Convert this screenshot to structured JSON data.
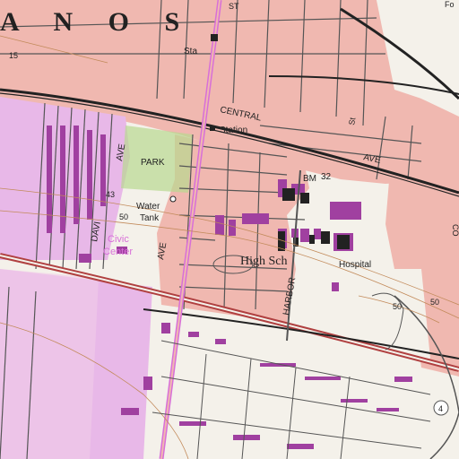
{
  "map": {
    "labels": {
      "city_partial": "A N O S",
      "station_top": "Sta",
      "station": "Station",
      "central_ave": "CENTRAL",
      "central_ave_suffix": "AVE",
      "park": "PARK",
      "bm": "BM",
      "bm_value": "32",
      "water_tank_1": "Water",
      "water_tank_2": "Tank",
      "civic_center_1": "Civic",
      "civic_center_2": "Center",
      "high_school": "High Sch",
      "hospital": "Hospital",
      "harbor": "HARBOR",
      "davi_ave": "DAVI",
      "ave_left": "AVE",
      "ave_right": "AVE",
      "contour_50_a": "50",
      "contour_50_b": "50",
      "contour_50_c": "50",
      "contour_43": "43",
      "contour_15": "15",
      "route_4": "4",
      "st_label": "ST",
      "st_label_2": "St",
      "co_label": "CO",
      "fo_label": "Fo"
    },
    "colors": {
      "urban_tint": "#f0b8b0",
      "purple_tint": "#e8b8e8",
      "road_red": "#b04040",
      "street": "#555555",
      "contour": "#c28a5a",
      "building": "#a040a0",
      "park_green": "#b8d890",
      "water_blue": "#4a7fb5",
      "background": "#f4f1ea"
    }
  }
}
